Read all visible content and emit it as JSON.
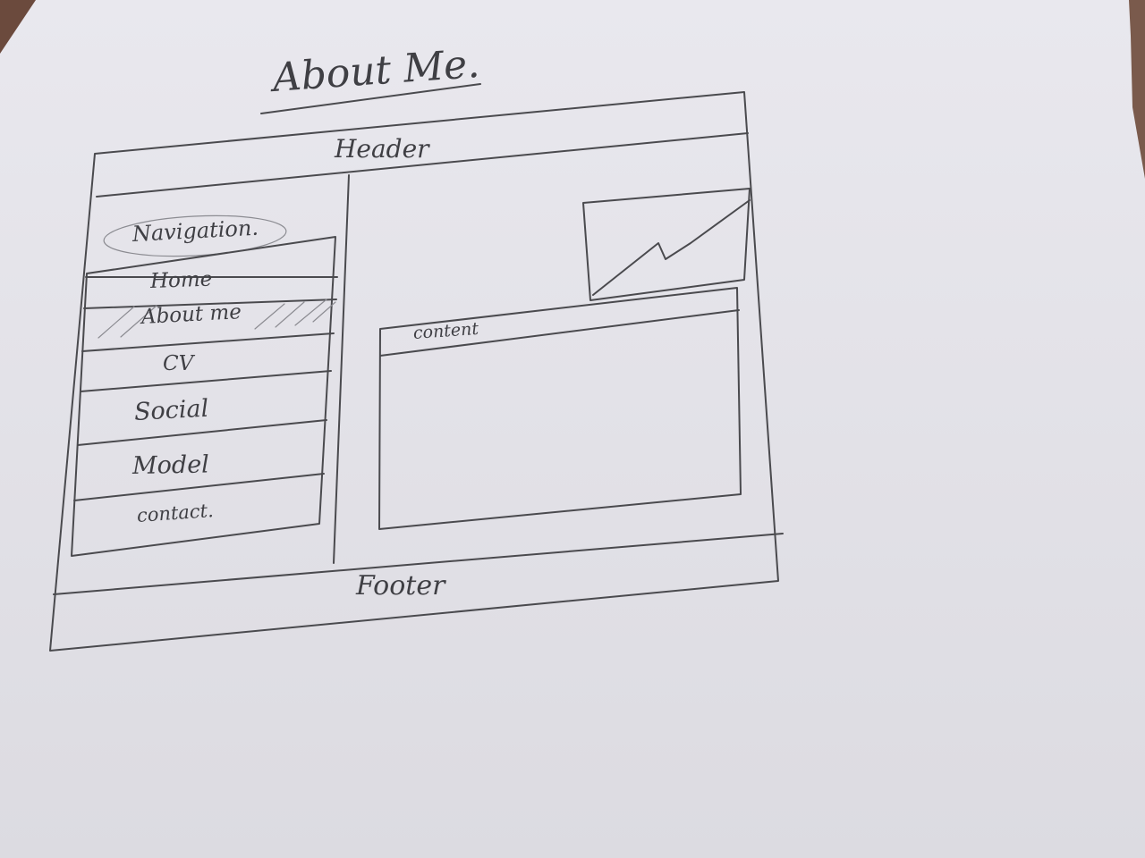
{
  "page": {
    "title": "About Me."
  },
  "wireframe": {
    "header_label": "Header",
    "navigation": {
      "label": "Navigation.",
      "items": [
        {
          "label": "Home"
        },
        {
          "label": "About me",
          "active": true
        },
        {
          "label": "CV"
        },
        {
          "label": "Social"
        },
        {
          "label": "Model"
        },
        {
          "label": "contact."
        }
      ]
    },
    "content_label": "content",
    "chart_icon": "line-chart-icon",
    "footer_label": "Footer"
  },
  "colors": {
    "pencil": "#4a4a4e",
    "paper": "#e6e5eb",
    "background": "#7a5a4c"
  }
}
